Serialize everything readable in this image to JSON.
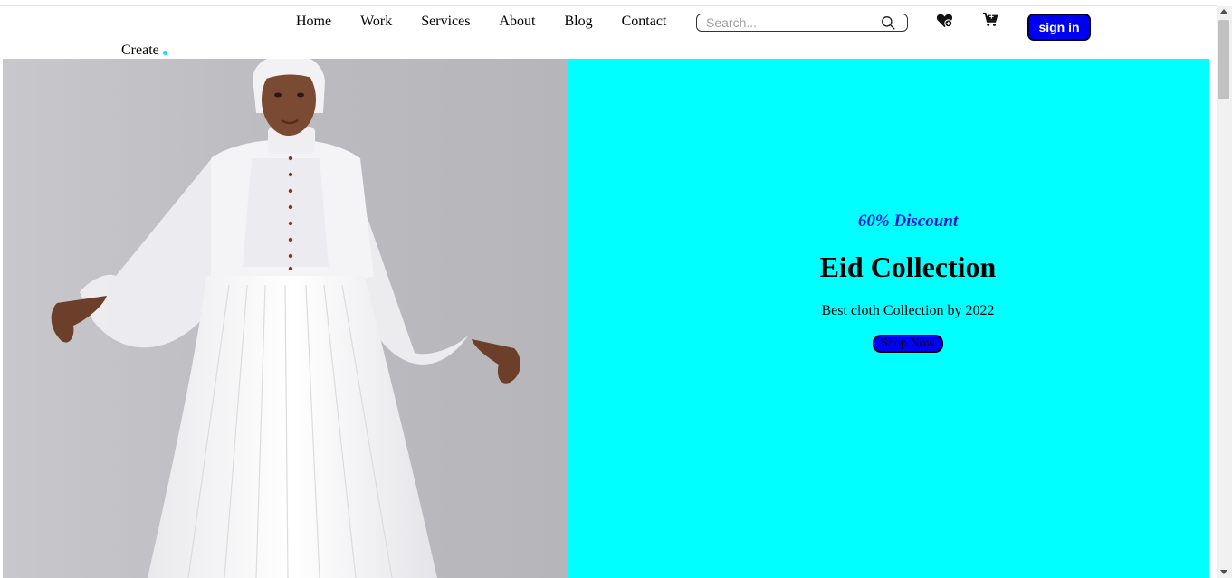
{
  "nav": {
    "links": [
      "Home",
      "Work",
      "Services",
      "About",
      "Blog",
      "Contact"
    ],
    "create_label": "Create"
  },
  "search": {
    "placeholder": "Search...",
    "value": ""
  },
  "icons": {
    "search": "search-icon",
    "wishlist": "heart-icon",
    "cart": "cart-icon"
  },
  "auth": {
    "signin_label": "sign in"
  },
  "hero": {
    "discount": "60% Discount",
    "title": "Eid Collection",
    "subtitle": "Best cloth Collection by 2022",
    "cta_label": "Shop Now",
    "image_alt": "model in white abaya dress"
  },
  "colors": {
    "accent": "#0000ff",
    "panel_bg": "#00ffff",
    "discount_text": "#1515e0",
    "create_dot": "#00e5ff"
  }
}
